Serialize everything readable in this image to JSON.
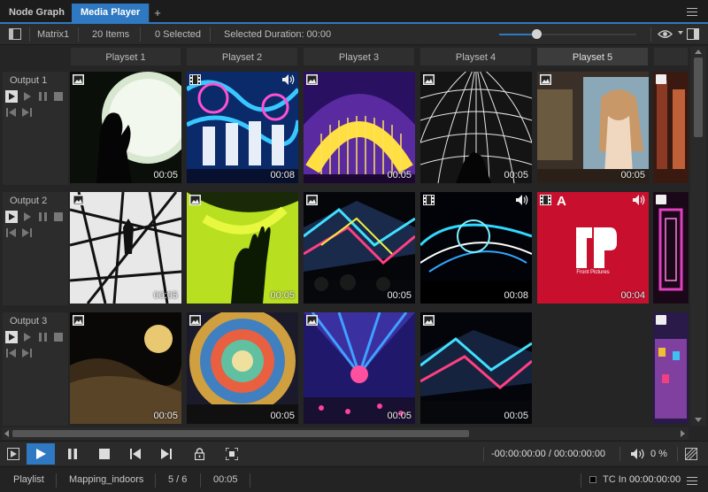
{
  "tabs": [
    {
      "label": "Node Graph",
      "active": false
    },
    {
      "label": "Media Player",
      "active": true
    }
  ],
  "add_tab_label": "+",
  "toolbar": {
    "matrix": "Matrix1",
    "items_count": "20 Items",
    "selected": "0 Selected",
    "selected_duration": "Selected Duration: 00:00",
    "zoom_level": 0.27
  },
  "playsets": [
    {
      "label": "Playset 1",
      "selected": false
    },
    {
      "label": "Playset 2",
      "selected": false
    },
    {
      "label": "Playset 3",
      "selected": false
    },
    {
      "label": "Playset 4",
      "selected": false
    },
    {
      "label": "Playset 5",
      "selected": true
    }
  ],
  "outputs": [
    {
      "label": "Output 1",
      "cells": [
        {
          "type": "image-icon",
          "duration": "00:05",
          "audio": false,
          "theme": "dark-silhouette"
        },
        {
          "type": "film-icon",
          "duration": "00:08",
          "audio": true,
          "theme": "dancers-blue"
        },
        {
          "type": "image-icon",
          "duration": "00:05",
          "audio": false,
          "theme": "golden-dome"
        },
        {
          "type": "image-icon",
          "duration": "00:05",
          "audio": false,
          "theme": "grid-dome"
        },
        {
          "type": "image-icon",
          "duration": "00:05",
          "audio": false,
          "theme": "gallery-venus"
        }
      ]
    },
    {
      "label": "Output 2",
      "cells": [
        {
          "type": "image-icon",
          "duration": "00:05",
          "audio": false,
          "theme": "bw-structure"
        },
        {
          "type": "image-icon",
          "duration": "00:05",
          "audio": false,
          "theme": "yellow-hand"
        },
        {
          "type": "image-icon",
          "duration": "00:05",
          "audio": false,
          "theme": "neon-stage"
        },
        {
          "type": "film-icon",
          "duration": "00:08",
          "audio": true,
          "theme": "neon-lines"
        },
        {
          "type": "film-icon",
          "duration": "00:04",
          "audio": true,
          "logo_text": "Front Pictures",
          "alpha_label": "A",
          "theme": "red-logo"
        }
      ]
    },
    {
      "label": "Output 3",
      "cells": [
        {
          "type": "image-icon",
          "duration": "00:05",
          "audio": false,
          "theme": "moon-night"
        },
        {
          "type": "image-icon",
          "duration": "00:05",
          "audio": false,
          "theme": "spiral-dome"
        },
        {
          "type": "image-icon",
          "duration": "00:05",
          "audio": false,
          "theme": "concert-lights"
        },
        {
          "type": "image-icon",
          "duration": "00:05",
          "audio": false,
          "theme": "neon-stage-2"
        },
        null
      ]
    }
  ],
  "transport": {
    "timecode": "-00:00:00:00 / 00:00:00:00",
    "volume": "0 %"
  },
  "status": {
    "playlist_label": "Playlist",
    "playlist_name": "Mapping_indoors",
    "position": "5 / 6",
    "duration": "00:05",
    "tc_label": "TC In",
    "tc_value": "00:00:00:00"
  },
  "colors": {
    "accent": "#2e79c2",
    "panel": "#2b2b2b",
    "background": "#252525"
  }
}
